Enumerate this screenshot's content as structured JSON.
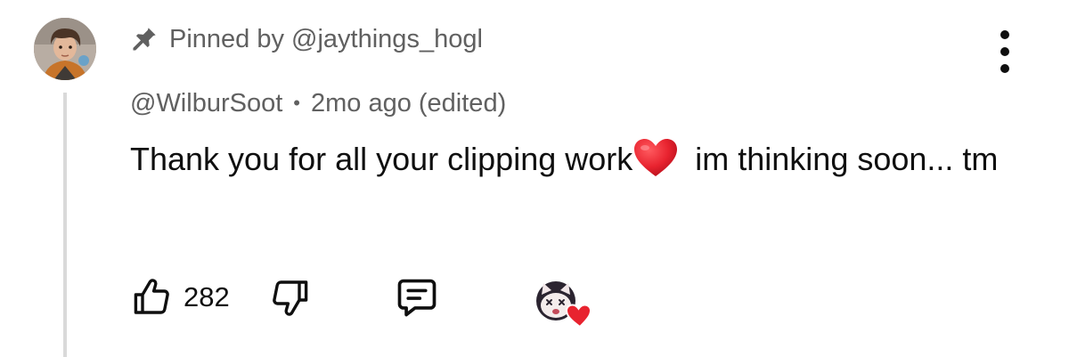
{
  "comment": {
    "pinned_text": "Pinned by @jaythings_hogl",
    "author": "@WilburSoot",
    "separator": "•",
    "timestamp": "2mo ago (edited)",
    "body_part1": "Thank you for all your clipping work",
    "body_emoji": "❤️",
    "body_part2": " im thinking soon... tm",
    "like_count": "282"
  },
  "icons": {
    "pin": "pin-icon",
    "more": "more-vertical-icon",
    "like": "thumbs-up-icon",
    "dislike": "thumbs-down-icon",
    "reply": "reply-comment-icon",
    "creator_heart": "creator-heart-icon"
  },
  "colors": {
    "text_primary": "#0f0f0f",
    "text_secondary": "#606060",
    "thread_line": "#d9d9d9",
    "heart_red": "#e8232f"
  }
}
